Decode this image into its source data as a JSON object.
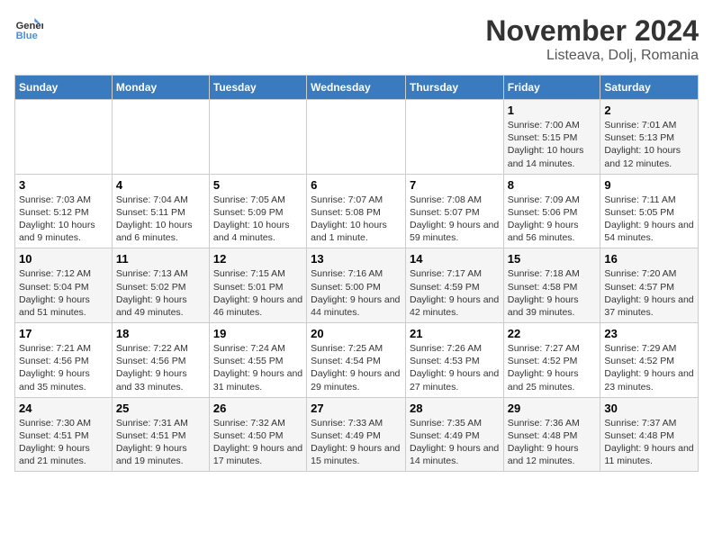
{
  "logo": {
    "line1": "General",
    "line2": "Blue"
  },
  "title": "November 2024",
  "location": "Listeava, Dolj, Romania",
  "weekdays": [
    "Sunday",
    "Monday",
    "Tuesday",
    "Wednesday",
    "Thursday",
    "Friday",
    "Saturday"
  ],
  "weeks": [
    [
      {
        "day": "",
        "info": ""
      },
      {
        "day": "",
        "info": ""
      },
      {
        "day": "",
        "info": ""
      },
      {
        "day": "",
        "info": ""
      },
      {
        "day": "",
        "info": ""
      },
      {
        "day": "1",
        "info": "Sunrise: 7:00 AM\nSunset: 5:15 PM\nDaylight: 10 hours and 14 minutes."
      },
      {
        "day": "2",
        "info": "Sunrise: 7:01 AM\nSunset: 5:13 PM\nDaylight: 10 hours and 12 minutes."
      }
    ],
    [
      {
        "day": "3",
        "info": "Sunrise: 7:03 AM\nSunset: 5:12 PM\nDaylight: 10 hours and 9 minutes."
      },
      {
        "day": "4",
        "info": "Sunrise: 7:04 AM\nSunset: 5:11 PM\nDaylight: 10 hours and 6 minutes."
      },
      {
        "day": "5",
        "info": "Sunrise: 7:05 AM\nSunset: 5:09 PM\nDaylight: 10 hours and 4 minutes."
      },
      {
        "day": "6",
        "info": "Sunrise: 7:07 AM\nSunset: 5:08 PM\nDaylight: 10 hours and 1 minute."
      },
      {
        "day": "7",
        "info": "Sunrise: 7:08 AM\nSunset: 5:07 PM\nDaylight: 9 hours and 59 minutes."
      },
      {
        "day": "8",
        "info": "Sunrise: 7:09 AM\nSunset: 5:06 PM\nDaylight: 9 hours and 56 minutes."
      },
      {
        "day": "9",
        "info": "Sunrise: 7:11 AM\nSunset: 5:05 PM\nDaylight: 9 hours and 54 minutes."
      }
    ],
    [
      {
        "day": "10",
        "info": "Sunrise: 7:12 AM\nSunset: 5:04 PM\nDaylight: 9 hours and 51 minutes."
      },
      {
        "day": "11",
        "info": "Sunrise: 7:13 AM\nSunset: 5:02 PM\nDaylight: 9 hours and 49 minutes."
      },
      {
        "day": "12",
        "info": "Sunrise: 7:15 AM\nSunset: 5:01 PM\nDaylight: 9 hours and 46 minutes."
      },
      {
        "day": "13",
        "info": "Sunrise: 7:16 AM\nSunset: 5:00 PM\nDaylight: 9 hours and 44 minutes."
      },
      {
        "day": "14",
        "info": "Sunrise: 7:17 AM\nSunset: 4:59 PM\nDaylight: 9 hours and 42 minutes."
      },
      {
        "day": "15",
        "info": "Sunrise: 7:18 AM\nSunset: 4:58 PM\nDaylight: 9 hours and 39 minutes."
      },
      {
        "day": "16",
        "info": "Sunrise: 7:20 AM\nSunset: 4:57 PM\nDaylight: 9 hours and 37 minutes."
      }
    ],
    [
      {
        "day": "17",
        "info": "Sunrise: 7:21 AM\nSunset: 4:56 PM\nDaylight: 9 hours and 35 minutes."
      },
      {
        "day": "18",
        "info": "Sunrise: 7:22 AM\nSunset: 4:56 PM\nDaylight: 9 hours and 33 minutes."
      },
      {
        "day": "19",
        "info": "Sunrise: 7:24 AM\nSunset: 4:55 PM\nDaylight: 9 hours and 31 minutes."
      },
      {
        "day": "20",
        "info": "Sunrise: 7:25 AM\nSunset: 4:54 PM\nDaylight: 9 hours and 29 minutes."
      },
      {
        "day": "21",
        "info": "Sunrise: 7:26 AM\nSunset: 4:53 PM\nDaylight: 9 hours and 27 minutes."
      },
      {
        "day": "22",
        "info": "Sunrise: 7:27 AM\nSunset: 4:52 PM\nDaylight: 9 hours and 25 minutes."
      },
      {
        "day": "23",
        "info": "Sunrise: 7:29 AM\nSunset: 4:52 PM\nDaylight: 9 hours and 23 minutes."
      }
    ],
    [
      {
        "day": "24",
        "info": "Sunrise: 7:30 AM\nSunset: 4:51 PM\nDaylight: 9 hours and 21 minutes."
      },
      {
        "day": "25",
        "info": "Sunrise: 7:31 AM\nSunset: 4:51 PM\nDaylight: 9 hours and 19 minutes."
      },
      {
        "day": "26",
        "info": "Sunrise: 7:32 AM\nSunset: 4:50 PM\nDaylight: 9 hours and 17 minutes."
      },
      {
        "day": "27",
        "info": "Sunrise: 7:33 AM\nSunset: 4:49 PM\nDaylight: 9 hours and 15 minutes."
      },
      {
        "day": "28",
        "info": "Sunrise: 7:35 AM\nSunset: 4:49 PM\nDaylight: 9 hours and 14 minutes."
      },
      {
        "day": "29",
        "info": "Sunrise: 7:36 AM\nSunset: 4:48 PM\nDaylight: 9 hours and 12 minutes."
      },
      {
        "day": "30",
        "info": "Sunrise: 7:37 AM\nSunset: 4:48 PM\nDaylight: 9 hours and 11 minutes."
      }
    ]
  ]
}
